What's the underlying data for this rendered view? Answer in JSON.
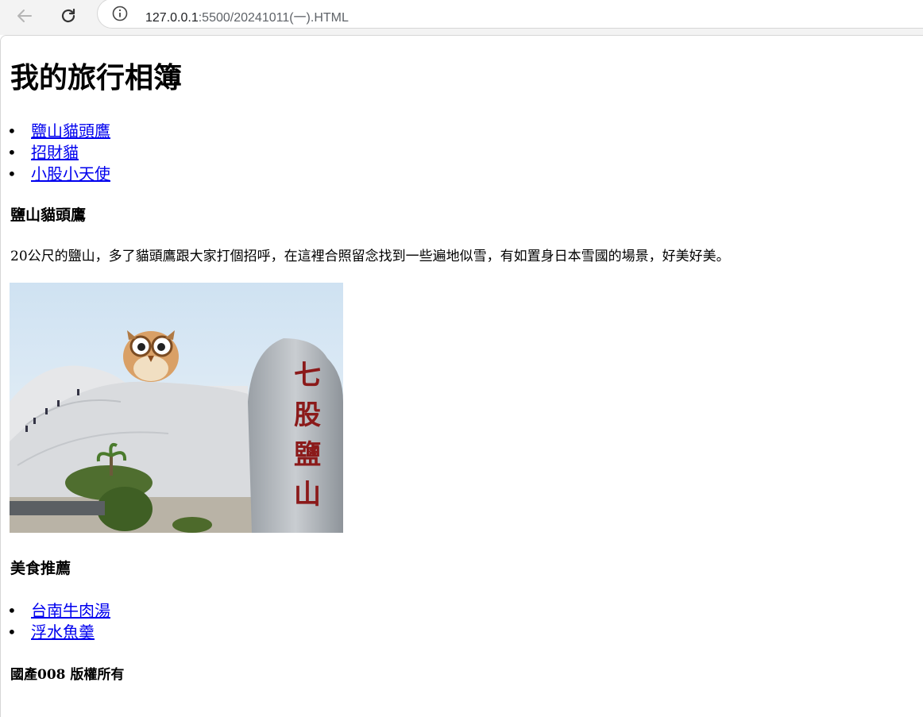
{
  "browser": {
    "url_host": "127.0.0.1",
    "url_rest": ":5500/20241011(一).HTML",
    "back_icon": "back-arrow-icon",
    "reload_icon": "reload-icon",
    "info_icon": "info-icon"
  },
  "page": {
    "title": "我的旅行相簿",
    "nav_links": [
      {
        "label": "鹽山貓頭鷹"
      },
      {
        "label": "招財貓"
      },
      {
        "label": "小股小天使"
      }
    ],
    "section1": {
      "heading": "鹽山貓頭鷹",
      "text": "20公尺的鹽山，多了貓頭鷹跟大家打個招呼，在這裡合照留念找到一些遍地似雪，有如置身日本雪國的場景，好美好美。",
      "photo_sign": "七股鹽山"
    },
    "section2": {
      "heading": "美食推薦",
      "links": [
        {
          "label": "台南牛肉湯"
        },
        {
          "label": "浮水魚羹"
        }
      ]
    },
    "footer": "國產008 版權所有"
  }
}
